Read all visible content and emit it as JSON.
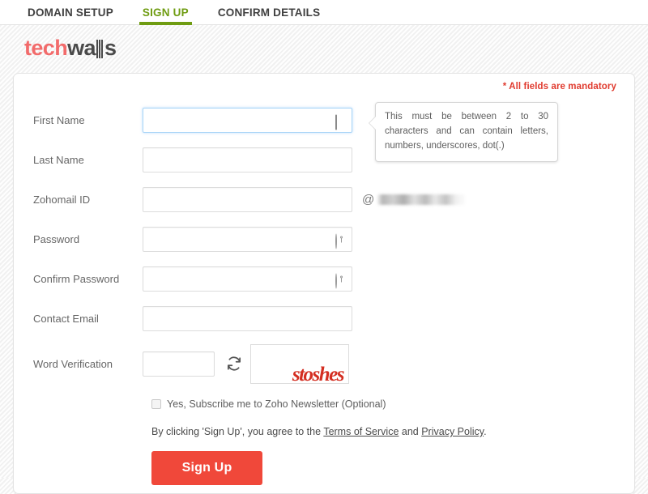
{
  "nav": {
    "items": [
      {
        "label": "DOMAIN SETUP",
        "active": false
      },
      {
        "label": "SIGN UP",
        "active": true
      },
      {
        "label": "CONFIRM DETAILS",
        "active": false
      }
    ],
    "active_color": "#6f9c12"
  },
  "brand": {
    "part1": "tech",
    "part2": "wa",
    "part3": "s",
    "part1_color": "#f26b6b",
    "part2_color": "#4a4a4a"
  },
  "card": {
    "mandatory_note": "* All fields are mandatory"
  },
  "tooltip": {
    "text": "This must be between 2 to 30 characters and can contain letters, numbers, underscores, dot(.)"
  },
  "form": {
    "fields": [
      {
        "label": "First Name",
        "value": "",
        "placeholder": "",
        "icon": "id-card-icon",
        "focused": true
      },
      {
        "label": "Last Name",
        "value": "",
        "placeholder": "",
        "icon": "",
        "focused": false
      },
      {
        "label": "Zohomail ID",
        "value": "",
        "placeholder": "",
        "icon": "",
        "focused": false
      },
      {
        "label": "Password",
        "value": "",
        "placeholder": "",
        "icon": "key-icon",
        "focused": false
      },
      {
        "label": "Confirm Password",
        "value": "",
        "placeholder": "",
        "icon": "key-icon",
        "focused": false
      },
      {
        "label": "Contact Email",
        "value": "",
        "placeholder": "",
        "icon": "",
        "focused": false
      }
    ],
    "at_symbol": "@",
    "domain_suffix": "",
    "word_verification": {
      "label": "Word Verification",
      "input_value": "",
      "refresh_icon": "refresh-icon",
      "captcha_text": "stoshes",
      "captcha_color": "#d42e21"
    },
    "newsletter": {
      "checked": false,
      "label": "Yes, Subscribe me to Zoho Newsletter (Optional)"
    },
    "terms": {
      "prefix": "By clicking 'Sign Up', you agree to the ",
      "link1": "Terms of Service",
      "middle": " and ",
      "link2": "Privacy Policy",
      "suffix": "."
    },
    "submit_label": "Sign Up",
    "submit_color": "#f0483a"
  }
}
